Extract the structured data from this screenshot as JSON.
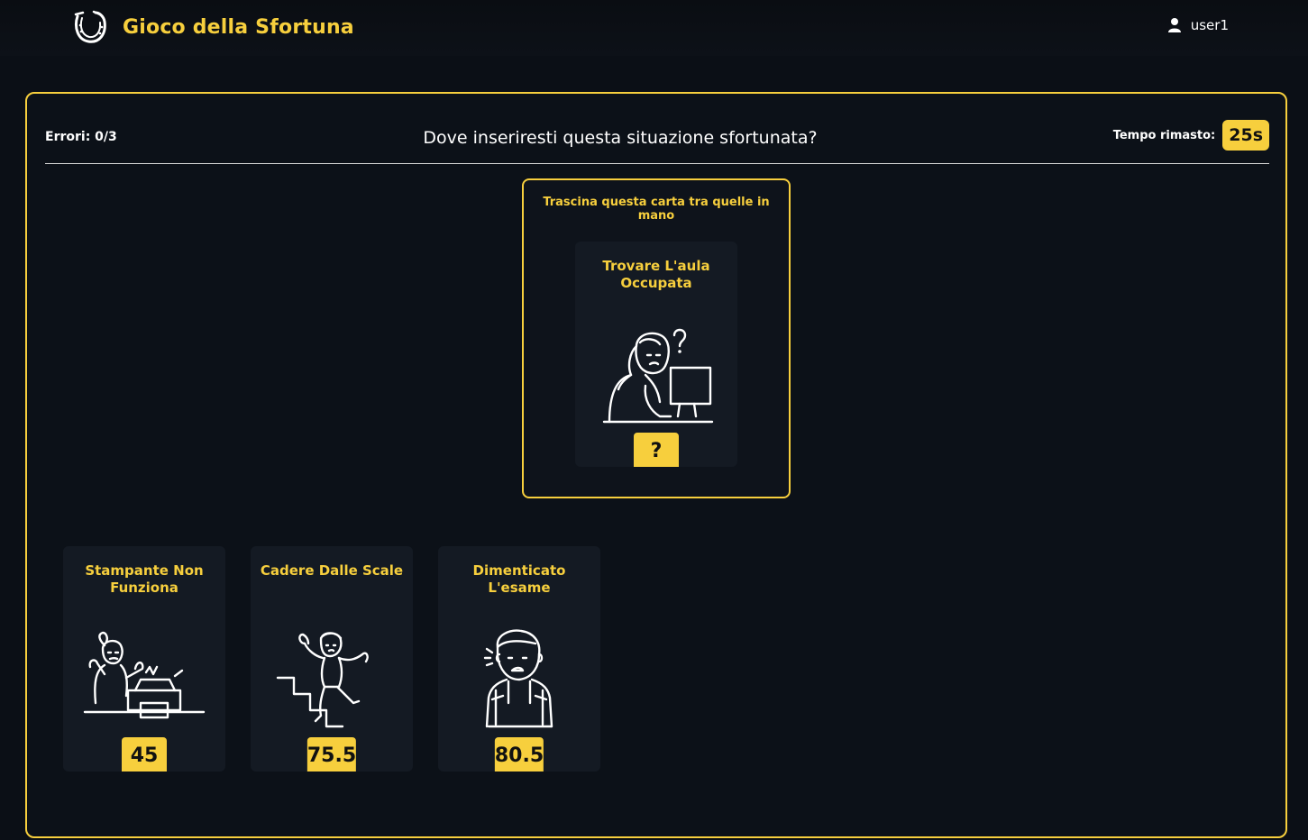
{
  "app": {
    "title": "Gioco della Sfortuna",
    "logo_icon": "horseshoe-icon",
    "user": {
      "name": "user1",
      "icon": "user-icon"
    }
  },
  "game": {
    "errors_label": "Errori: 0/3",
    "question": "Dove inseriresti questa situazione sfortunata?",
    "timer_label": "Tempo rimasto:",
    "timer_value": "25s",
    "accent_color": "#f7cf3d",
    "draw_area": {
      "hint": "Trascina questa carta tra quelle in mano",
      "card": {
        "title": "Trovare L'aula Occupata",
        "index": "?",
        "illustration": "confused-woman-at-computer"
      }
    },
    "hand": [
      {
        "title": "Stampante Non Funziona",
        "index": "45",
        "illustration": "woman-broken-printer"
      },
      {
        "title": "Cadere Dalle Scale",
        "index": "75.5",
        "illustration": "man-falling-stairs"
      },
      {
        "title": "Dimenticato L'esame",
        "index": "80.5",
        "illustration": "worried-student-backpack"
      }
    ]
  }
}
